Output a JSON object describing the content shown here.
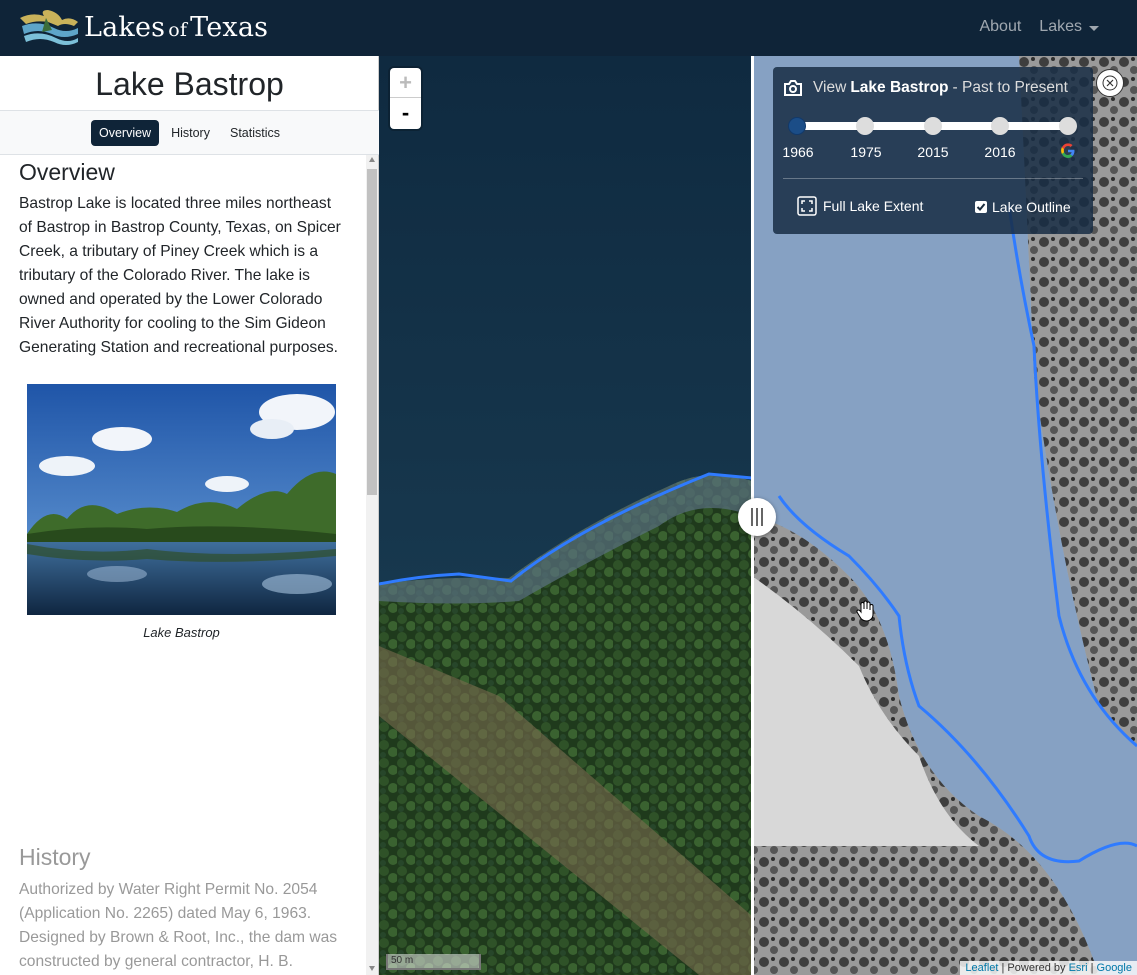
{
  "navbar": {
    "brand_main": "Lakes",
    "brand_of": "of",
    "brand_end": "Texas",
    "links": [
      "About",
      "Lakes"
    ]
  },
  "sidebar": {
    "title": "Lake Bastrop",
    "tabs": [
      "Overview",
      "History",
      "Statistics"
    ],
    "overview_heading": "Overview",
    "overview_text": "Bastrop Lake is located three miles northeast of Bastrop in Bastrop County, Texas, on Spicer Creek, a tributary of Piney Creek which is a tributary of the Colorado River. The lake is owned and operated by the Lower Colorado River Authority for cooling to the Sim Gideon Generating Station and recreational purposes.",
    "photo_caption": "Lake Bastrop",
    "history_heading": "History",
    "history_text": "Authorized by Water Right Permit No. 2054 (Application No. 2265) dated May 6, 1963. Designed by Brown & Root, Inc., the dam was constructed by general contractor, H. B."
  },
  "map": {
    "zoom_in": "+",
    "zoom_out": "-",
    "scale_label": "50 m",
    "attribution": {
      "leaflet": "Leaflet",
      "sep1": " | Powered by ",
      "esri": "Esri",
      "sep2": " | ",
      "google": "Google"
    }
  },
  "timeline": {
    "view_label": "View",
    "lake_name": "Lake Bastrop",
    "suffix": "- Past to Present",
    "years": [
      "1966",
      "1975",
      "2015",
      "2016"
    ],
    "active_year": "1966",
    "full_extent_label": "Full Lake Extent",
    "outline_label": "Lake Outline",
    "outline_checked": true
  },
  "colors": {
    "navbar": "#0f2438",
    "accent": "#1b4d87",
    "outline": "#2f7bff"
  }
}
